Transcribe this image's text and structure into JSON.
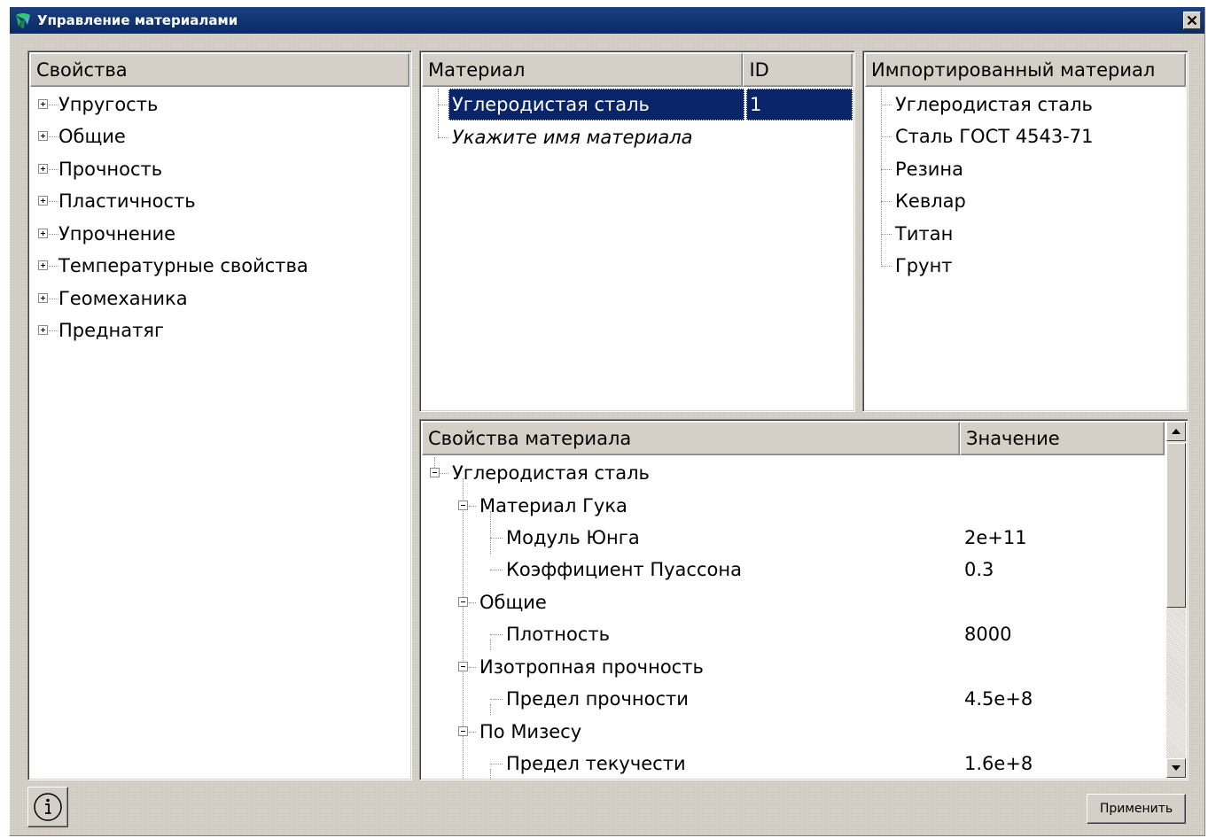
{
  "window": {
    "title": "Управление материалами"
  },
  "icons": {
    "app": "app-logo-icon",
    "close": "close-icon",
    "info": "info-icon",
    "expand": "plus-expander-icon",
    "collapse": "minus-expander-icon",
    "scroll_up": "scroll-up-arrow-icon",
    "scroll_down": "scroll-down-arrow-icon"
  },
  "colors": {
    "titlebar": "#0b2a66",
    "selection": "#0a246a",
    "face": "#d4d0c8"
  },
  "properties_panel": {
    "header": "Свойства",
    "items": [
      {
        "label": "Упругость"
      },
      {
        "label": "Общие"
      },
      {
        "label": "Прочность"
      },
      {
        "label": "Пластичность"
      },
      {
        "label": "Упрочнение"
      },
      {
        "label": "Температурные свойства"
      },
      {
        "label": "Геомеханика"
      },
      {
        "label": "Преднатяг"
      }
    ]
  },
  "materials_panel": {
    "columns": [
      "Материал",
      "ID"
    ],
    "rows": [
      {
        "name": "Углеродистая сталь",
        "id": "1"
      }
    ],
    "placeholder": "Укажите имя материала"
  },
  "imported_panel": {
    "header": "Импортированный материал",
    "items": [
      {
        "label": "Углеродистая сталь"
      },
      {
        "label": "Сталь ГОСТ 4543-71"
      },
      {
        "label": "Резина"
      },
      {
        "label": "Кевлар"
      },
      {
        "label": "Титан"
      },
      {
        "label": "Грунт"
      }
    ]
  },
  "material_props_panel": {
    "columns": [
      "Свойства материала",
      "Значение"
    ],
    "rows": [
      {
        "label": "Углеродистая сталь",
        "value": ""
      },
      {
        "label": "Материал Гука",
        "value": ""
      },
      {
        "label": "Модуль Юнга",
        "value": "2e+11"
      },
      {
        "label": "Коэффициент Пуассона",
        "value": "0.3"
      },
      {
        "label": "Общие",
        "value": ""
      },
      {
        "label": "Плотность",
        "value": "8000"
      },
      {
        "label": "Изотропная прочность",
        "value": ""
      },
      {
        "label": "Предел прочности",
        "value": "4.5e+8"
      },
      {
        "label": "По Мизесу",
        "value": ""
      },
      {
        "label": "Предел текучести",
        "value": "1.6e+8"
      }
    ]
  },
  "footer": {
    "apply_label": "Применить"
  }
}
